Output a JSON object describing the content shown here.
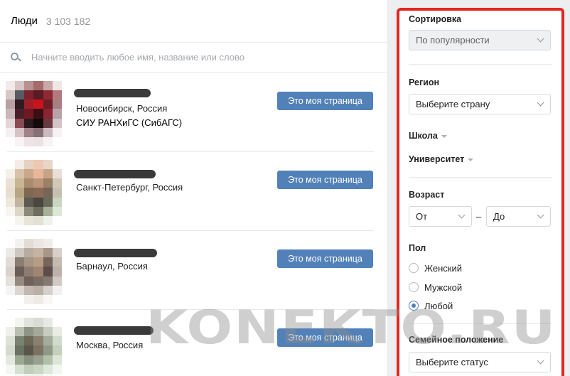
{
  "results": {
    "title": "Люди",
    "count": "3 103 182",
    "search_placeholder": "Начните вводить любое имя, название или слово",
    "people": [
      {
        "city": "Новосибирск, Россия",
        "university": "СИУ РАНХиГС (СибАГС)",
        "button": "Это моя страница"
      },
      {
        "city": "Санкт-Петербург, Россия",
        "university": "",
        "button": "Это моя страница"
      },
      {
        "city": "Барнаул, Россия",
        "university": "",
        "button": "Это моя страница"
      },
      {
        "city": "Москва, Россия",
        "university": "",
        "button": "Это моя страница"
      }
    ]
  },
  "filters": {
    "sort": {
      "label": "Сортировка",
      "value": "По популярности"
    },
    "region": {
      "label": "Регион",
      "value": "Выберите страну"
    },
    "school": {
      "label": "Школа"
    },
    "university": {
      "label": "Университет"
    },
    "age": {
      "label": "Возраст",
      "from": "От",
      "to": "До",
      "dash": "–"
    },
    "gender": {
      "label": "Пол",
      "options": [
        "Женский",
        "Мужской",
        "Любой"
      ],
      "selected": "Любой"
    },
    "marital": {
      "label": "Семейное положение",
      "value": "Выберите статус"
    }
  },
  "watermark": "KONEKTO.RU",
  "colors": {
    "accent": "#5181b8",
    "highlight_border": "#e1271f",
    "background": "#edeef0"
  }
}
